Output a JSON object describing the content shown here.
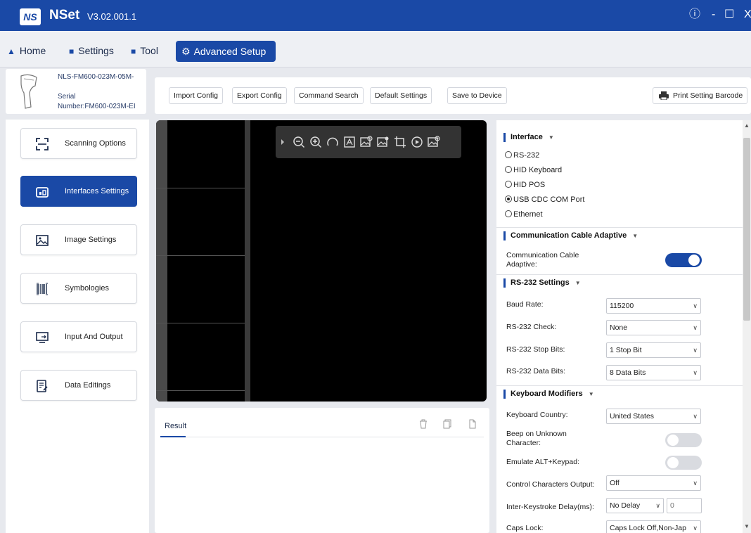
{
  "app": {
    "logo_text": "NS",
    "name": "NSet",
    "version": "V3.02.001.1"
  },
  "window_controls": {
    "info": "ⓘ",
    "minimize": "-",
    "maximize": "☐",
    "close": "X"
  },
  "menu": {
    "home": "Home",
    "settings": "Settings",
    "tool": "Tool",
    "advanced_setup": "Advanced Setup"
  },
  "device": {
    "model": "NLS-FM600-023M-05M-",
    "serial_line1": "Serial",
    "serial_line2": "Number:FM600-023M-EI"
  },
  "sidebar": {
    "items": [
      {
        "label": "Scanning Options",
        "icon": "scan-frame-icon",
        "active": false
      },
      {
        "label": "Interfaces Settings",
        "icon": "interface-icon",
        "active": true
      },
      {
        "label": "Image Settings",
        "icon": "image-icon",
        "active": false
      },
      {
        "label": "Symbologies",
        "icon": "barcode-icon",
        "active": false
      },
      {
        "label": "Input And Output",
        "icon": "monitor-io-icon",
        "active": false
      },
      {
        "label": "Data Editings",
        "icon": "edit-document-icon",
        "active": false
      }
    ]
  },
  "toolbar": {
    "import_config": "Import Config",
    "export_config": "Export Config",
    "command_search": "Command Search",
    "default_settings": "Default Settings",
    "save_to_device": "Save to Device",
    "print_setting_barcode": "Print Setting Barcode"
  },
  "result": {
    "tab_label": "Result"
  },
  "settings": {
    "interface": {
      "title": "Interface",
      "options": [
        {
          "label": "RS-232",
          "selected": false
        },
        {
          "label": "HID Keyboard",
          "selected": false
        },
        {
          "label": "HID POS",
          "selected": false
        },
        {
          "label": "USB CDC COM Port",
          "selected": true
        },
        {
          "label": "Ethernet",
          "selected": false
        }
      ]
    },
    "comm_cable": {
      "title": "Communication Cable Adaptive",
      "label_line1": "Communication Cable",
      "label_line2": "Adaptive:",
      "enabled": true
    },
    "rs232": {
      "title": "RS-232 Settings",
      "baud_rate_label": "Baud Rate:",
      "baud_rate_value": "115200",
      "check_label": "RS-232 Check:",
      "check_value": "None",
      "stop_bits_label": "RS-232 Stop Bits:",
      "stop_bits_value": "1 Stop Bit",
      "data_bits_label": "RS-232 Data Bits:",
      "data_bits_value": "8 Data Bits"
    },
    "keyboard": {
      "title": "Keyboard Modifiers",
      "country_label": "Keyboard Country:",
      "country_value": "United States",
      "beep_label_line1": "Beep on Unknown",
      "beep_label_line2": "Character:",
      "beep_enabled": false,
      "emulate_label": "Emulate ALT+Keypad:",
      "emulate_enabled": false,
      "control_chars_label": "Control Characters Output:",
      "control_chars_value": "Off",
      "delay_label": "Inter-Keystroke Delay(ms):",
      "delay_value": "No Delay",
      "delay_input_placeholder": "0",
      "caps_label": "Caps Lock:",
      "caps_value": "Caps Lock Off,Non-Jap"
    }
  },
  "colors": {
    "accent": "#1a49a6",
    "title_bar": "#1a49a6",
    "toggle_off": "#d9dbe0"
  }
}
